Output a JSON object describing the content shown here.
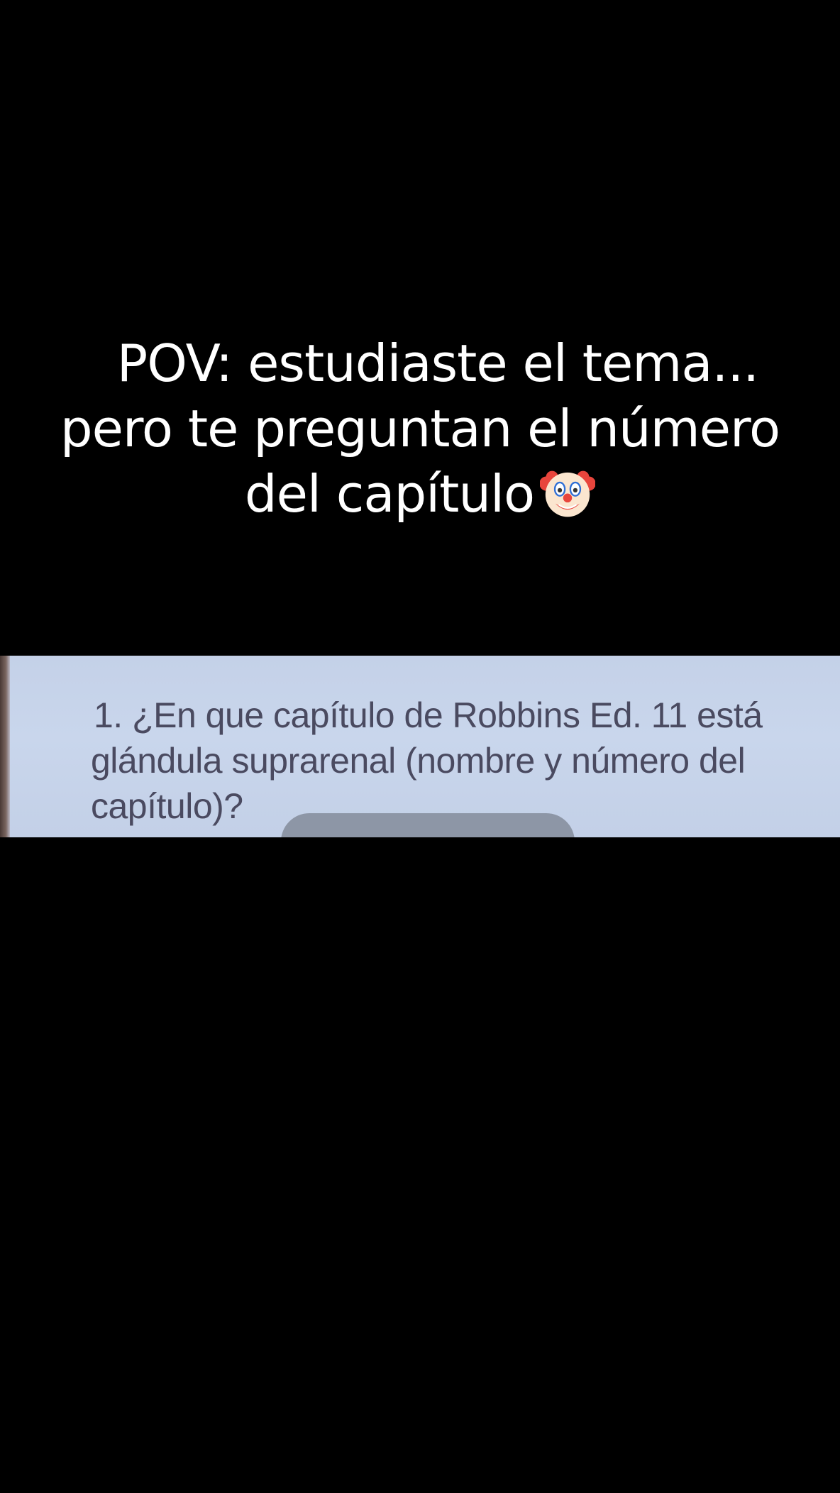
{
  "caption": {
    "line_1": "POV: estudiaste el tema...",
    "line_2": "pero te preguntan el número",
    "line_3": "del capítulo",
    "emoji_icon": "clown-face-icon"
  },
  "photo": {
    "question_line_1": "1. ¿En que capítulo de Robbins Ed. 11 está",
    "question_line_2": "glándula suprarenal (nombre y número del",
    "question_line_3": "capítulo)?"
  },
  "colors": {
    "background": "#000000",
    "caption_text": "#ffffff",
    "photo_paper": "#c7d4ea",
    "photo_text": "#4a4a60"
  }
}
